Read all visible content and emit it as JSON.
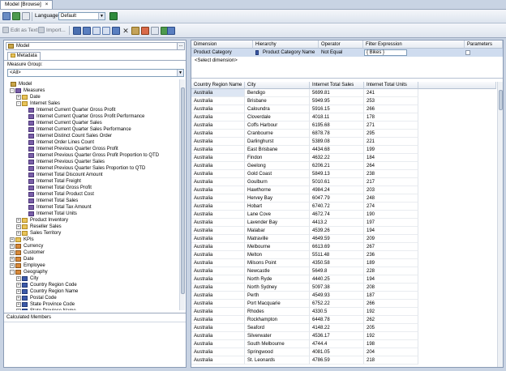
{
  "window": {
    "tab_title": "Model [Browse]",
    "close_glyph": "×"
  },
  "toolbar1": {
    "language_label": "Language:",
    "language_value": "Default"
  },
  "toolbar2": {
    "edit_as_text": "Edit as Text",
    "import": "Import..."
  },
  "left_pane": {
    "cube_name": "Model",
    "browse_button": "...",
    "metadata_tab": "Metadata",
    "measure_group_label": "Measure Group:",
    "measure_group_value": "<All>",
    "calculated_members": "Calculated Members"
  },
  "tree": [
    {
      "label": "Model",
      "level": 0,
      "icon": "cube",
      "exp": ""
    },
    {
      "label": "Measures",
      "level": 1,
      "icon": "measure",
      "exp": "-"
    },
    {
      "label": "Date",
      "level": 2,
      "icon": "folder",
      "exp": "+"
    },
    {
      "label": "Internet Sales",
      "level": 2,
      "icon": "folder",
      "exp": "-"
    },
    {
      "label": "Internet Current Quarter Gross Profit",
      "level": 3,
      "icon": "measure",
      "exp": ""
    },
    {
      "label": "Internet Current Quarter Gross Profit Performance",
      "level": 3,
      "icon": "measure",
      "exp": ""
    },
    {
      "label": "Internet Current Quarter Sales",
      "level": 3,
      "icon": "measure",
      "exp": ""
    },
    {
      "label": "Internet Current Quarter Sales Performance",
      "level": 3,
      "icon": "measure",
      "exp": ""
    },
    {
      "label": "Internet Distinct Count Sales Order",
      "level": 3,
      "icon": "measure",
      "exp": ""
    },
    {
      "label": "Internet Order Lines Count",
      "level": 3,
      "icon": "measure",
      "exp": ""
    },
    {
      "label": "Internet Previous Quarter Gross Profit",
      "level": 3,
      "icon": "measure",
      "exp": ""
    },
    {
      "label": "Internet Previous Quarter Gross Profit Proportion to QTD",
      "level": 3,
      "icon": "measure",
      "exp": ""
    },
    {
      "label": "Internet Previous Quarter Sales",
      "level": 3,
      "icon": "measure",
      "exp": ""
    },
    {
      "label": "Internet Previous Quarter Sales Proportion to QTD",
      "level": 3,
      "icon": "measure",
      "exp": ""
    },
    {
      "label": "Internet Total Discount Amount",
      "level": 3,
      "icon": "measure",
      "exp": ""
    },
    {
      "label": "Internet Total Freight",
      "level": 3,
      "icon": "measure",
      "exp": ""
    },
    {
      "label": "Internet Total Gross Profit",
      "level": 3,
      "icon": "measure",
      "exp": ""
    },
    {
      "label": "Internet Total Product Cost",
      "level": 3,
      "icon": "measure",
      "exp": ""
    },
    {
      "label": "Internet Total Sales",
      "level": 3,
      "icon": "measure",
      "exp": ""
    },
    {
      "label": "Internet Total Tax Amount",
      "level": 3,
      "icon": "measure",
      "exp": ""
    },
    {
      "label": "Internet Total Units",
      "level": 3,
      "icon": "measure",
      "exp": ""
    },
    {
      "label": "Product Inventory",
      "level": 2,
      "icon": "folder",
      "exp": "+"
    },
    {
      "label": "Reseller Sales",
      "level": 2,
      "icon": "folder",
      "exp": "+"
    },
    {
      "label": "Sales Territory",
      "level": 2,
      "icon": "folder",
      "exp": "+"
    },
    {
      "label": "KPIs",
      "level": 1,
      "icon": "folder",
      "exp": "+"
    },
    {
      "label": "Currency",
      "level": 1,
      "icon": "dim",
      "exp": "+"
    },
    {
      "label": "Customer",
      "level": 1,
      "icon": "dim",
      "exp": "+"
    },
    {
      "label": "Date",
      "level": 1,
      "icon": "dim",
      "exp": "+"
    },
    {
      "label": "Employee",
      "level": 1,
      "icon": "dim",
      "exp": "+"
    },
    {
      "label": "Geography",
      "level": 1,
      "icon": "dim",
      "exp": "-"
    },
    {
      "label": "City",
      "level": 2,
      "icon": "attr",
      "exp": "+"
    },
    {
      "label": "Country Region Code",
      "level": 2,
      "icon": "attr",
      "exp": "+"
    },
    {
      "label": "Country Region Name",
      "level": 2,
      "icon": "attr",
      "exp": "+"
    },
    {
      "label": "Postal Code",
      "level": 2,
      "icon": "attr",
      "exp": "+"
    },
    {
      "label": "State Province Code",
      "level": 2,
      "icon": "attr",
      "exp": "+"
    },
    {
      "label": "State Province Name",
      "level": 2,
      "icon": "attr",
      "exp": "+"
    }
  ],
  "filter": {
    "headers": [
      "Dimension",
      "Hierarchy",
      "Operator",
      "Filter Expression",
      "Parameters"
    ],
    "row": {
      "dimension": "Product Category",
      "hierarchy": "Product Category Name",
      "operator": "Not Equal",
      "expression": "{ Bikes }"
    },
    "select_dimension": "<Select dimension>"
  },
  "grid": {
    "headers": [
      "Country Region Name",
      "City",
      "Internet Total Sales",
      "Internet Total Units"
    ],
    "rows": [
      [
        "Australia",
        "Bendigo",
        "5699.81",
        "241"
      ],
      [
        "Australia",
        "Brisbane",
        "5949.95",
        "253"
      ],
      [
        "Australia",
        "Caloundra",
        "5916.15",
        "266"
      ],
      [
        "Australia",
        "Cloverdale",
        "4018.11",
        "178"
      ],
      [
        "Australia",
        "Coffs Harbour",
        "6195.68",
        "271"
      ],
      [
        "Australia",
        "Cranbourne",
        "6878.78",
        "295"
      ],
      [
        "Australia",
        "Darlinghurst",
        "5389.08",
        "221"
      ],
      [
        "Australia",
        "East Brisbane",
        "4434.68",
        "199"
      ],
      [
        "Australia",
        "Findon",
        "4632.22",
        "184"
      ],
      [
        "Australia",
        "Geelong",
        "6206.21",
        "264"
      ],
      [
        "Australia",
        "Gold Coast",
        "5849.13",
        "238"
      ],
      [
        "Australia",
        "Goulburn",
        "5010.61",
        "217"
      ],
      [
        "Australia",
        "Hawthorne",
        "4984.24",
        "203"
      ],
      [
        "Australia",
        "Hervey Bay",
        "6047.79",
        "248"
      ],
      [
        "Australia",
        "Hobart",
        "6740.72",
        "274"
      ],
      [
        "Australia",
        "Lane Cove",
        "4672.74",
        "190"
      ],
      [
        "Australia",
        "Lavender Bay",
        "4413.2",
        "197"
      ],
      [
        "Australia",
        "Malabar",
        "4539.26",
        "194"
      ],
      [
        "Australia",
        "Matraville",
        "4649.59",
        "209"
      ],
      [
        "Australia",
        "Melbourne",
        "6613.69",
        "267"
      ],
      [
        "Australia",
        "Melton",
        "5511.48",
        "236"
      ],
      [
        "Australia",
        "Milsons Point",
        "4350.58",
        "189"
      ],
      [
        "Australia",
        "Newcastle",
        "5649.8",
        "228"
      ],
      [
        "Australia",
        "North Ryde",
        "4440.25",
        "194"
      ],
      [
        "Australia",
        "North Sydney",
        "5097.38",
        "208"
      ],
      [
        "Australia",
        "Perth",
        "4549.93",
        "187"
      ],
      [
        "Australia",
        "Port Macquarie",
        "6752.22",
        "266"
      ],
      [
        "Australia",
        "Rhodes",
        "4330.5",
        "192"
      ],
      [
        "Australia",
        "Rockhampton",
        "6448.78",
        "262"
      ],
      [
        "Australia",
        "Seaford",
        "4148.22",
        "205"
      ],
      [
        "Australia",
        "Silverwater",
        "4536.17",
        "192"
      ],
      [
        "Australia",
        "South Melbourne",
        "4744.4",
        "198"
      ],
      [
        "Australia",
        "Springwood",
        "4081.05",
        "204"
      ],
      [
        "Australia",
        "St. Leonards",
        "4786.59",
        "218"
      ]
    ]
  },
  "colors": {
    "measure_icon": "#7a5fa8",
    "dimension_icon": "#d9893a",
    "attribute_icon": "#3d5aa8",
    "folder_icon": "#e9c45a",
    "selection": "#cfdcef"
  }
}
